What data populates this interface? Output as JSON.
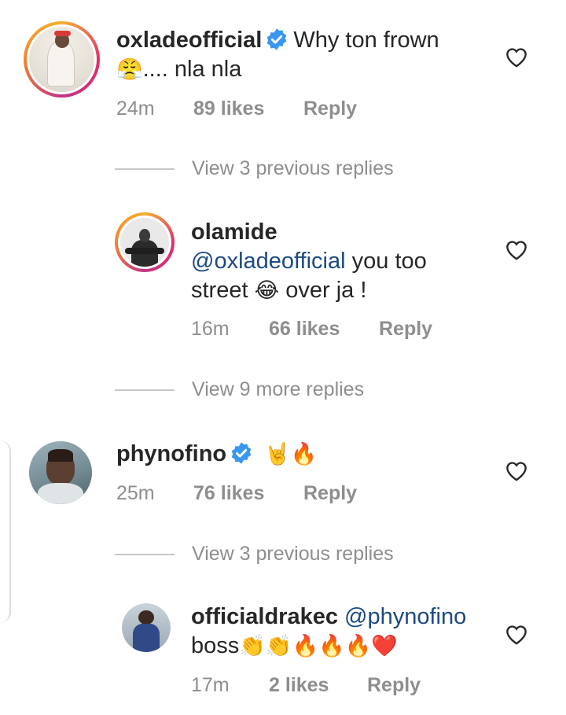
{
  "comments": [
    {
      "username": "oxladeofficial",
      "verified": true,
      "text_line1": "Why ton frown",
      "text_line2_emoji": "😤",
      "text_line2": ".... nla nla",
      "time": "24m",
      "likes": "89 likes",
      "reply": "Reply",
      "view_replies": "View 3 previous replies"
    },
    {
      "username": "olamide",
      "verified": false,
      "mention": "@oxladeofficial",
      "text_after_mention": " you too",
      "text_line3a": "street",
      "emoji": "😂",
      "text_line3b": "over ja !",
      "time": "16m",
      "likes": "66 likes",
      "reply": "Reply",
      "view_replies": "View 9 more replies"
    },
    {
      "username": "phynofino",
      "verified": true,
      "emojis": "🤘🔥",
      "time": "25m",
      "likes": "76 likes",
      "reply": "Reply",
      "view_replies": "View 3 previous replies"
    },
    {
      "username": "officialdrakec",
      "verified": false,
      "mention": "@phynofino",
      "text": "boss",
      "emojis": "👏👏🔥🔥🔥❤️",
      "time": "17m",
      "likes": "2 likes",
      "reply": "Reply"
    }
  ],
  "icons": {
    "heart": "heart-outline-icon",
    "verified": "verified-badge-icon"
  },
  "colors": {
    "text": "#262626",
    "meta": "#8e8e8e",
    "mention": "#1c4a82",
    "verified": "#3897f0"
  }
}
